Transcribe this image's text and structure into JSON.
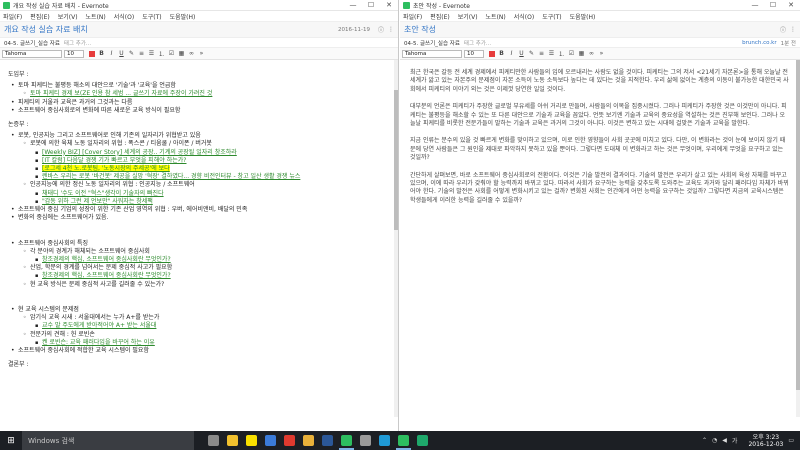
{
  "left": {
    "window_title": "개요 작성 실습 자료 배치 - Evernote",
    "menu": [
      "파일(F)",
      "편집(E)",
      "보기(V)",
      "노트(N)",
      "서식(O)",
      "도구(T)",
      "도움말(H)"
    ],
    "note_title": "개요 작성 실습 자료 배치",
    "date": "2016-11-19",
    "notebook": "04-5. 글쓰기_실습 자료",
    "tag_placeholder": "태그 추가...",
    "font": "Tahoma",
    "font_size": "10",
    "lines": [
      {
        "lvl": "sec",
        "text": "도입부 :"
      },
      {
        "lvl": "l1",
        "text": "토마 피케티는 불평등 해소의 대안으로 '기술'과 '교육'을 언급함"
      },
      {
        "lvl": "l2",
        "text": "토마 피케티 경제 보(ZE 인용 참 세범 ... 글쓰기 자료에 주장이 가려진 것",
        "link": true
      },
      {
        "lvl": "l1",
        "text": "피케티의 거울과 교육은 과거의 그것과는 다름"
      },
      {
        "lvl": "l1",
        "text": "소프트웨어 중심사회로의 변화에 따른 새로운 교육 방식이 필요함"
      },
      {
        "lvl": "sec",
        "text": "논증부 :"
      },
      {
        "lvl": "l1",
        "text": "로봇, 인공지능 그리고 소프트웨어로 인해 기존의 일자리가 위협받고 있음"
      },
      {
        "lvl": "l2",
        "text": "로봇에 의한 육체 노동 일자리의 위협 : 폭스콘 / 티움쿨 / 아이폰 / 버거봇"
      },
      {
        "lvl": "l3",
        "text": "[Weekly BIZ] [Cover Story] 세계의 공장.. 기계의 공장될 일자리 창조하라",
        "link": true
      },
      {
        "lvl": "l3",
        "text": "[IT 칼럼] 다음달 경쟁 기가 빠르고 부엇을 피해야 하는가?",
        "link": true
      },
      {
        "lvl": "l3",
        "text": "[로그세 4천 노.로봇팀, '노동시장의 주세공'에 보다",
        "link": true,
        "hl": true
      },
      {
        "lvl": "l3",
        "text": "렌바스 우리는 로봇 '바건봇' 제공을 실망 '혁장' 결하였다... 경향 비전인터뷰 - 창고 일산 생활 경쟁 뉴스",
        "link": true
      },
      {
        "lvl": "l2",
        "text": "인공지능에 의한 정신 노동 일자리의 위협 : 인공지능 / 소프트웨어"
      },
      {
        "lvl": "l3",
        "text": "채태디 '수도 이전 \"혁스\"생각이 기술자의 빠진다",
        "link": true
      },
      {
        "lvl": "l3",
        "text": "\"감동 위하 그런 제 언보만\" 사워자는 창세팩",
        "link": true
      },
      {
        "lvl": "l1",
        "text": "소프트웨어 중심 기업의 성장이 위한 기존 산업 영역의 위협 : 우버, 에어비앤비, 배달의 민족"
      },
      {
        "lvl": "l1",
        "text": "변화의 중심에는 소프트웨어가 있음."
      },
      {
        "lvl": "sec",
        "text": ""
      },
      {
        "lvl": "l1",
        "text": "소프트웨어 중심사회의 특징"
      },
      {
        "lvl": "l2",
        "text": "각 분야의 경계가 해체되는 소프트웨어 중심사회"
      },
      {
        "lvl": "l3",
        "text": "창조경제의 핵심, 소프트웨어 중심사회란 무엇인가?",
        "link": true
      },
      {
        "lvl": "l2",
        "text": "산업, 학문의 경계를 넘어서는 문제 중심적 사고가 필요함"
      },
      {
        "lvl": "l3",
        "text": "창조경제의 핵심, 소프트웨어 중심사회란 무엇인가?",
        "link": true
      },
      {
        "lvl": "l2",
        "text": "현 교육 방식은 문제 중심적 사고를 길러줄 수 있는가?"
      },
      {
        "lvl": "sec",
        "text": ""
      },
      {
        "lvl": "l1",
        "text": "현 교육 시스템의 문제점"
      },
      {
        "lvl": "l2",
        "text": "암기식 교육 시새 : 서울대에서는 누가 A+를 받는가"
      },
      {
        "lvl": "l3",
        "text": "교수 말 주도에게 받아적어야 A+ 받는 서울대",
        "link": true
      },
      {
        "lvl": "l2",
        "text": "전문가의 견해 : 헌 로빈손"
      },
      {
        "lvl": "l3",
        "text": "켄 로빈슨: 교육 패러다임을 바꾸어 하는 이유",
        "link": true
      },
      {
        "lvl": "l1",
        "text": "소프트웨어 중심사회에 적합한 교육 시스템이 필요함"
      },
      {
        "lvl": "sec",
        "text": "결론부 :"
      }
    ]
  },
  "right": {
    "window_title": "초안 작성 - Evernote",
    "menu": [
      "파일(F)",
      "편집(E)",
      "보기(V)",
      "노트(N)",
      "서식(O)",
      "도구(T)",
      "도움말(H)"
    ],
    "note_title": "초안 작성",
    "notebook": "04-5. 글쓰기_실습 자료",
    "tag_placeholder": "태그 추가...",
    "source_link": "brunch.co.kr",
    "page_info": "1분 전",
    "font": "Tahoma",
    "font_size": "10",
    "paragraphs": [
      "최근 한국은 갈등 전 세계 경제에서 피케티만한 사람들의 입에 오르내리는 사람도 없을 것이다. 피케티는 그의 저서 <21세기 자본론>을 통해 오늘날 전 세계가 앓고 있는 자본주의 문제점이 자본 소득이 노동 소득보다 높다는 데 있다는 것을 지적한다. 우리 삶에 없이는 계층의 이동이 불가능한 대한민국 사회에서 피케티의 이야기 외는 것은 이제껏 당연한 일일 것이다.",
      "대부분의 언론은 피케티가 주장한 글로벌 부유세를 아쉬 거리로 만들며, 사람들의 이목을 집중시켰다. 그러나 피케티가 주장한 것은 이것만이 아니다. 피케티는 불평등을 해소할 수 있는 또 다른 대안으로 기술과 교육을 꼽았다. 언뜻 보기엔 기술과 교육의 중요성을 역설하는 것은 진부해 보인다. 그러나 오늘날 피케티를 비롯한 전문가들이 말하는 기술과 교육은 과거의 그것이 아니다. 이것은 변하고 있는 시대에 걸맞은 기술과 교육을 말한다.",
      "지금 인류는 분수의 있을 것 빠르게 변화를 맞이하고 있으며, 이로 인한 영향들이 사회 곳곳에 미치고 있다. 다만, 이 변화라는 것이 눈에 보이지 않기 때문에 당연 사람들은 그 원인을 제대로 파악하지 못하고 있을 뿐이다. 그렇다면 도대체 이 변화라고 하는 것은 무엇이며, 우리에게 무엇을 요구하고 있는 것일까?",
      "간단하게 살펴보면, 바로 소프트웨어 중심사회로의 전환이다. 이것은 기술 발전의 결과이다. 기술의 발전은 우리가 살고 있는 사회의 육성 자체를 바꾸고 있으며, 이에 따라 우리가 갖춰야 할 능력까지 바뀌고 있다. 따라서 사회가 요구하는 능력을 갖추도록 도와주는 교육도 과거와 달리 패러다임 자체가 바뀌어야 한다. 기술의 발전은 사회를 어떻게 변화시키고 있는 걸까? 변화된 사회는 인간에게 어떤 능력을 요구하는 것일까? 그렇다면 지금의 교육시스템은 학생들에게 이러한 능력을 길러줄 수 있을까?"
    ]
  },
  "taskbar": {
    "search_placeholder": "Windows 검색",
    "time": "오후 3:23",
    "date": "2016-12-03",
    "apps": [
      {
        "name": "task-view",
        "color": "#8a8a8a",
        "active": false
      },
      {
        "name": "explorer",
        "color": "#f2c12e",
        "active": false
      },
      {
        "name": "kakaotalk",
        "color": "#f9e000",
        "active": false
      },
      {
        "name": "store",
        "color": "#3b7bd9",
        "active": false
      },
      {
        "name": "music",
        "color": "#e03a2f",
        "active": false
      },
      {
        "name": "chrome",
        "color": "#e9b13a",
        "active": false
      },
      {
        "name": "word",
        "color": "#2b5797",
        "active": false
      },
      {
        "name": "evernote-1",
        "color": "#2dbe60",
        "active": true
      },
      {
        "name": "notepad",
        "color": "#9a9a9a",
        "active": false
      },
      {
        "name": "photos",
        "color": "#1f9ad6",
        "active": false
      },
      {
        "name": "evernote-2",
        "color": "#2dbe60",
        "active": true
      },
      {
        "name": "camtasia",
        "color": "#1ea86b",
        "active": false
      }
    ]
  }
}
